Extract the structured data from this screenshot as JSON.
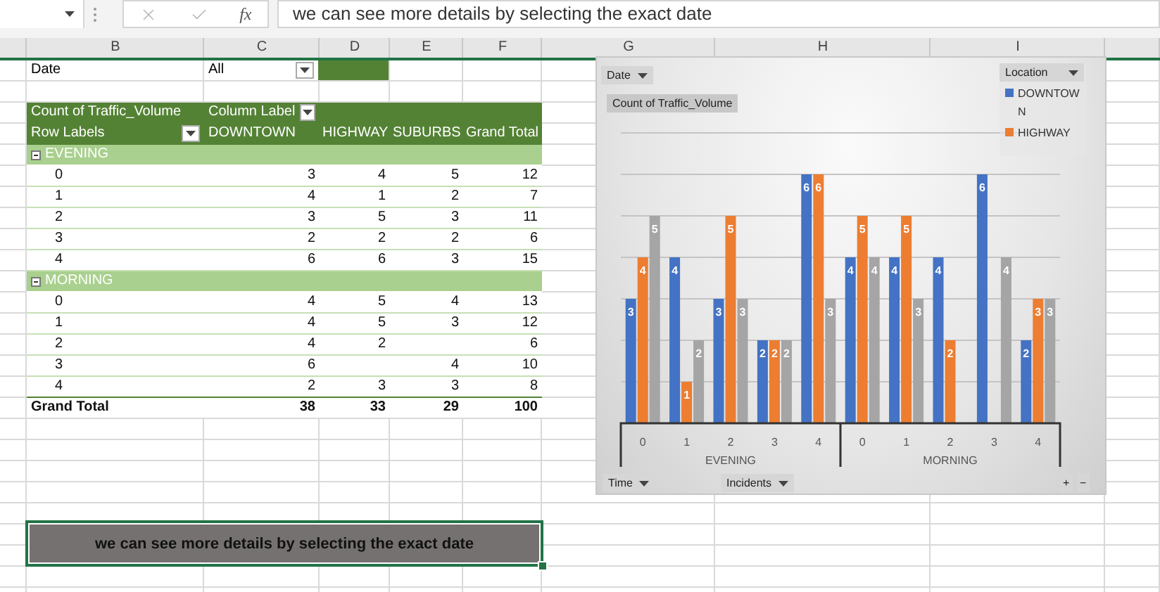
{
  "formula_bar": {
    "function_label": "fx",
    "value": "we can see more details by selecting the exact date"
  },
  "column_headers": [
    "B",
    "C",
    "D",
    "E",
    "F",
    "G",
    "H",
    "I"
  ],
  "page_filter": {
    "field": "Date",
    "value": "All"
  },
  "pivot": {
    "value_field": "Count of Traffic_Volume",
    "column_labels": "Column Label",
    "row_labels": "Row Labels",
    "columns": [
      "DOWNTOWN",
      "HIGHWAY",
      "SUBURBS",
      "Grand Total"
    ],
    "groups": [
      {
        "label": "EVENING",
        "expanded": true,
        "rows": [
          {
            "label": "0",
            "cells": {
              "col_1": "3",
              "col_2": "4",
              "col_3": "5",
              "col_4": "12"
            }
          },
          {
            "label": "1",
            "cells": {
              "col_1": "4",
              "col_2": "1",
              "col_3": "2",
              "col_4": "7"
            }
          },
          {
            "label": "2",
            "cells": {
              "col_1": "3",
              "col_2": "5",
              "col_3": "3",
              "col_4": "11"
            }
          },
          {
            "label": "3",
            "cells": {
              "col_1": "2",
              "col_2": "2",
              "col_3": "2",
              "col_4": "6"
            }
          },
          {
            "label": "4",
            "cells": {
              "col_1": "6",
              "col_2": "6",
              "col_3": "3",
              "col_4": "15"
            }
          }
        ]
      },
      {
        "label": "MORNING",
        "expanded": true,
        "rows": [
          {
            "label": "0",
            "cells": {
              "col_1": "4",
              "col_2": "5",
              "col_3": "4",
              "col_4": "13"
            }
          },
          {
            "label": "1",
            "cells": {
              "col_1": "4",
              "col_2": "5",
              "col_3": "3",
              "col_4": "12"
            }
          },
          {
            "label": "2",
            "cells": {
              "col_1": "4",
              "col_2": "2",
              "col_4": "6"
            }
          },
          {
            "label": "3",
            "cells": {
              "col_1": "6",
              "col_3": "4",
              "col_4": "10"
            }
          },
          {
            "label": "4",
            "cells": {
              "col_1": "2",
              "col_2": "3",
              "col_3": "3",
              "col_4": "8"
            }
          }
        ]
      }
    ],
    "grand_total": {
      "label": "Grand Total",
      "values": [
        "38",
        "33",
        "29",
        "100"
      ]
    }
  },
  "chart": {
    "report_filter": "Date",
    "value_button": "Count of Traffic_Volume",
    "legend_field": "Location",
    "axis_fields": [
      "Time",
      "Incidents"
    ],
    "zoom_buttons": [
      "+",
      "−"
    ],
    "axis_groups": [
      "EVENING",
      "MORNING"
    ],
    "chart_data": {
      "type": "bar",
      "categories": [
        "0",
        "1",
        "2",
        "3",
        "4",
        "0",
        "1",
        "2",
        "3",
        "4"
      ],
      "ylim": [
        0,
        7
      ],
      "data_labels": true,
      "series": [
        {
          "name": "DOWNTOWN",
          "color": "#4472c4",
          "values": [
            3,
            4,
            3,
            2,
            6,
            4,
            4,
            4,
            6,
            2
          ]
        },
        {
          "name": "HIGHWAY",
          "color": "#ed7d31",
          "values": [
            4,
            1,
            5,
            2,
            6,
            5,
            5,
            2,
            null,
            3
          ]
        },
        {
          "color": "#a5a5a5",
          "values": [
            5,
            2,
            3,
            2,
            3,
            4,
            3,
            null,
            4,
            3
          ]
        }
      ]
    }
  },
  "note": "we can see more details by selecting the exact date"
}
